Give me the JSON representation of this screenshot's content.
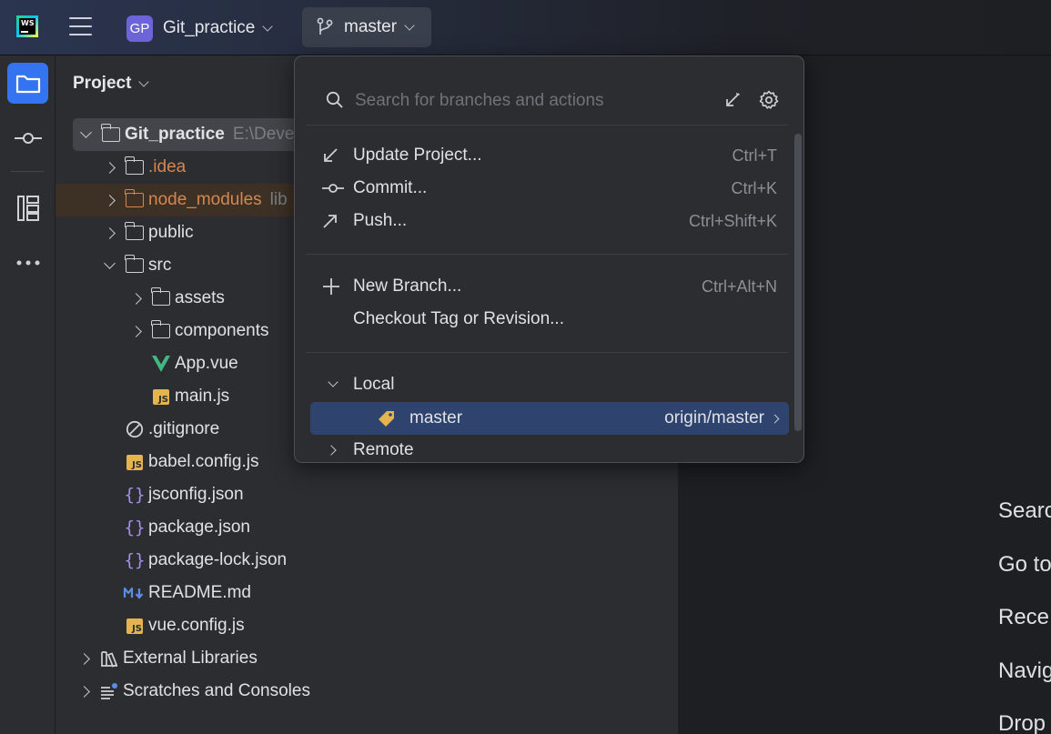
{
  "titlebar": {
    "project_badge": "GP",
    "project_name": "Git_practice",
    "branch_name": "master"
  },
  "project_panel": {
    "title": "Project",
    "items": [
      {
        "label": "Git_practice",
        "hint": "E:\\Devel",
        "icon": "folder-icon"
      },
      {
        "label": ".idea",
        "icon": "folder-icon"
      },
      {
        "label": "node_modules",
        "hint": "lib",
        "icon": "folder-icon"
      },
      {
        "label": "public",
        "icon": "folder-icon"
      },
      {
        "label": "src",
        "icon": "folder-icon"
      },
      {
        "label": "assets",
        "icon": "folder-icon"
      },
      {
        "label": "components",
        "icon": "folder-icon"
      },
      {
        "label": "App.vue",
        "icon": "vue-icon"
      },
      {
        "label": "main.js",
        "icon": "js-icon"
      },
      {
        "label": ".gitignore",
        "icon": "ignore-icon"
      },
      {
        "label": "babel.config.js",
        "icon": "js-icon"
      },
      {
        "label": "jsconfig.json",
        "icon": "json-icon"
      },
      {
        "label": "package.json",
        "icon": "json-icon"
      },
      {
        "label": "package-lock.json",
        "icon": "json-icon"
      },
      {
        "label": "README.md",
        "icon": "markdown-icon"
      },
      {
        "label": "vue.config.js",
        "icon": "js-icon"
      },
      {
        "label": "External Libraries",
        "icon": "library-icon"
      },
      {
        "label": "Scratches and Consoles",
        "icon": "scratches-icon"
      }
    ]
  },
  "popup": {
    "search_placeholder": "Search for branches and actions",
    "actions": [
      {
        "label": "Update Project...",
        "shortcut": "Ctrl+T",
        "icon": "update-arrow-icon"
      },
      {
        "label": "Commit...",
        "shortcut": "Ctrl+K",
        "icon": "commit-icon"
      },
      {
        "label": "Push...",
        "shortcut": "Ctrl+Shift+K",
        "icon": "push-arrow-icon"
      },
      {
        "label": "New Branch...",
        "shortcut": "Ctrl+Alt+N",
        "icon": "plus-icon"
      },
      {
        "label": "Checkout Tag or Revision...",
        "shortcut": ""
      }
    ],
    "local_label": "Local",
    "branch": {
      "name": "master",
      "tracking": "origin/master"
    },
    "remote_label": "Remote"
  },
  "editor_hints": [
    "Searc",
    "Go to",
    "Rece",
    "Navig",
    "Drop"
  ],
  "colors": {
    "accent": "#3574f0",
    "selection": "#2e436e",
    "excluded": "#d6864f",
    "branch_tag": "#e5b44e"
  }
}
